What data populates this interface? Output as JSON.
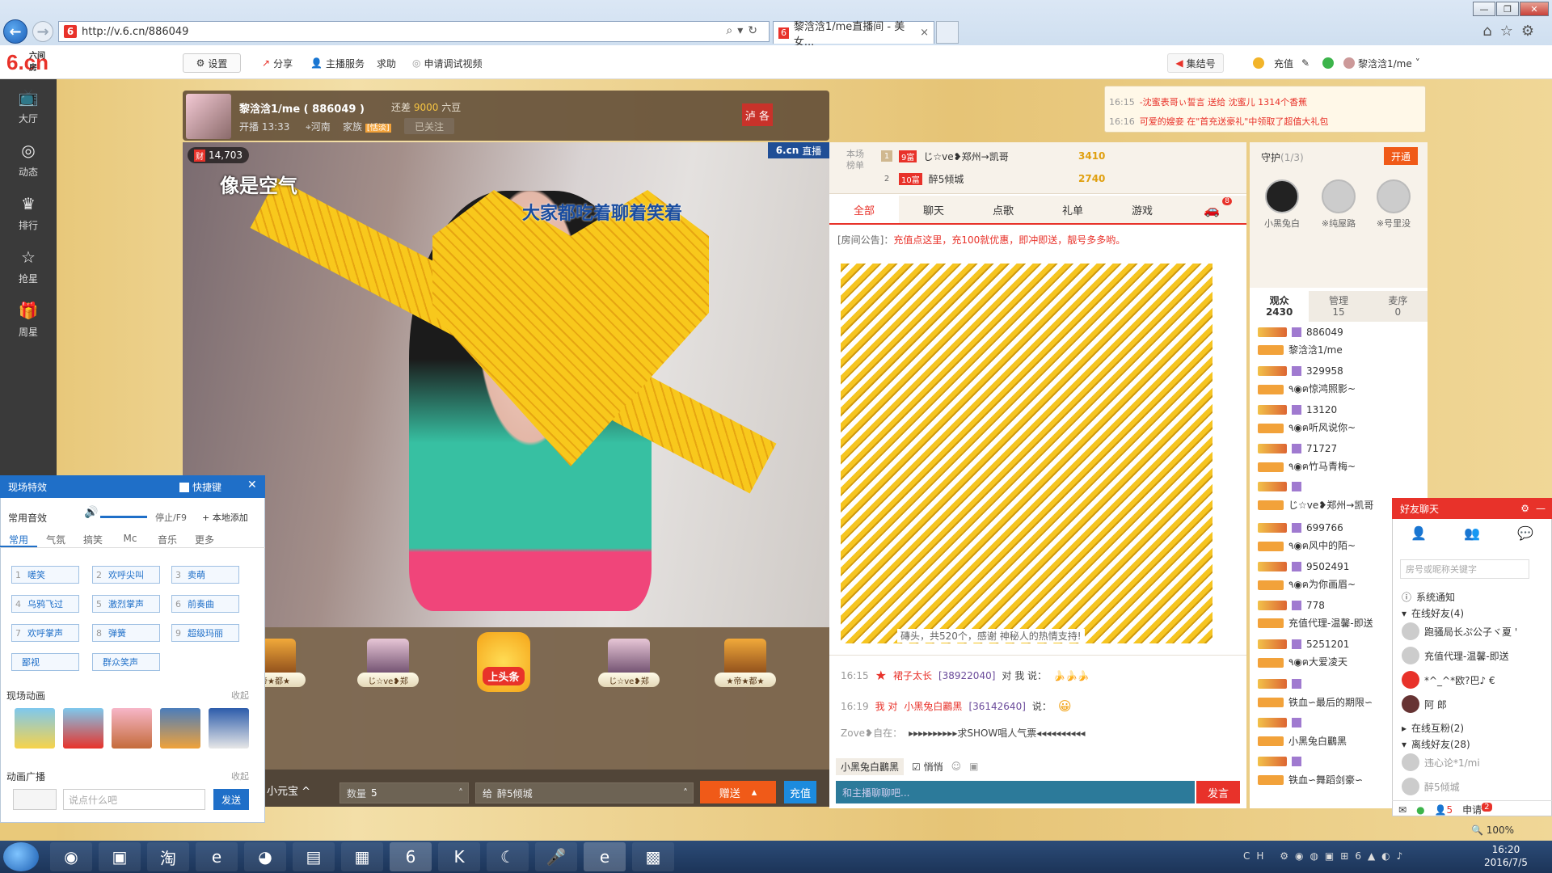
{
  "browser": {
    "url": "http://v.6.cn/886049",
    "tab_title": "黎浛浛1/me直播间 - 美女...",
    "tab_close": "×"
  },
  "site": {
    "logo": "6.cn",
    "logo_small": "六间房",
    "settings": "设置",
    "share": "分享",
    "anchor_service": "主播服务",
    "help": "求助",
    "apply_debug": "申请调试视频",
    "jiejie": "集结号",
    "recharge": "充值",
    "username": "黎浛浛1/me"
  },
  "left_nav": [
    {
      "label": "大厅",
      "icon": "tv-icon"
    },
    {
      "label": "动态",
      "icon": "compass-icon"
    },
    {
      "label": "排行",
      "icon": "crown-icon"
    },
    {
      "label": "抢星",
      "icon": "star-icon"
    },
    {
      "label": "周星",
      "icon": "gift-icon"
    }
  ],
  "anchor": {
    "name": "黎浛浛1/me ( 886049 )",
    "diff_prefix": "还差",
    "diff_value": "9000",
    "diff_suffix": "六豆",
    "started": "开播 13:33",
    "location": "河南",
    "family_label": "家族",
    "family_badge": "[恬淡]",
    "follow": "已关注",
    "flag": "泸 各"
  },
  "video": {
    "viewers": "14,703",
    "text1": "像是空气",
    "text2": "大家都吃着聊着笑着",
    "brand": "6.cn",
    "live": "直播"
  },
  "gifts": [
    {
      "label": "帝★都★"
    },
    {
      "label": "じ☆ve❥郑"
    },
    {
      "label": "上头条"
    },
    {
      "label": "じ☆ve❥郑"
    },
    {
      "label": "★帝★都★"
    }
  ],
  "send": {
    "treasure": "小元宝 ^",
    "qty_label": "数量",
    "qty": "5",
    "to_label": "给",
    "to": "醉5倾城",
    "give": "赠送",
    "charge": "充值"
  },
  "rank": {
    "label": "本场榜单",
    "rows": [
      {
        "n": "1",
        "level": "9富",
        "name": "じ☆ve❥郑州→凯哥",
        "val": "3410"
      },
      {
        "n": "2",
        "level": "10富",
        "name": "醉5倾城",
        "val": "2740"
      }
    ]
  },
  "chat_tabs": [
    "全部",
    "聊天",
    "点歌",
    "礼单",
    "游戏"
  ],
  "chat_tab_badge": "8",
  "notice": {
    "label": "[房间公告]：",
    "text": "充值点这里，充100就优惠，即冲即送，靓号多多哟。"
  },
  "pencil_caption": "磚头，共520个，感谢 神秘人的热情支持!",
  "chat": [
    {
      "time": "16:15",
      "name": "裙子太长",
      "id": "[38922040]",
      "text": "对 我 说："
    },
    {
      "time": "16:19",
      "name": "我 对",
      "target": "小黑兔白鸝黑",
      "id": "[36142640]",
      "text": "说："
    },
    {
      "time": "",
      "name": "Zove❥自在：",
      "text": "▸▸▸▸▸▸▸▸▸▸求SHOW唱人气票◂◂◂◂◂◂◂◂◂◂"
    }
  ],
  "chat_bar": {
    "target": "小黑兔白鸝黑",
    "quiet": "悄悄"
  },
  "chat_input": {
    "placeholder": "和主播聊聊吧...",
    "send": "发言"
  },
  "messages": [
    {
      "time": "16:15",
      "text": "-沈蜜表哥ぃ誓言 送给 沈蜜儿 1314个香蕉"
    },
    {
      "time": "16:16",
      "text": "可爱的嫂妾 在\"首充送豪礼\"中领取了超值大礼包"
    }
  ],
  "guard": {
    "title": "守护",
    "count": "(1/3)",
    "open": "开通",
    "members": [
      "小黑兔白",
      "※纯屋路",
      "※号里没"
    ]
  },
  "user_tabs": [
    {
      "label": "观众",
      "count": "2430"
    },
    {
      "label": "管理",
      "count": "15"
    },
    {
      "label": "麦序",
      "count": "0"
    }
  ],
  "users": [
    {
      "id": "886049",
      "sub": "黎浛浛1/me"
    },
    {
      "id": "329958",
      "sub": "٩◉ฅ惊鸿照影~"
    },
    {
      "id": "13120",
      "sub": "٩◉ฅ听风说你~"
    },
    {
      "id": "71727",
      "sub": "٩◉ฅ竹马青梅~"
    },
    {
      "id": "",
      "sub": "じ☆ve❥郑州→凯哥"
    },
    {
      "id": "699766",
      "sub": "٩◉ฅ风中的陌~"
    },
    {
      "id": "9502491",
      "sub": "٩◉ฅ为你画眉~"
    },
    {
      "id": "778",
      "sub": "充值代理-温馨-即送"
    },
    {
      "id": "5251201",
      "sub": "٩◉ฅ大爱凌天"
    },
    {
      "id": "",
      "sub": "铁血∽最后的期限∽"
    },
    {
      "id": "",
      "sub": "小黑兔白鸝黑"
    },
    {
      "id": "",
      "sub": "铁血∽舞蹈剑豪∽"
    }
  ],
  "sound": {
    "title": "现场特效",
    "shortcut": "快捷键",
    "common": "常用音效",
    "stop": "停止/F9",
    "add": "本地添加",
    "tabs": [
      "常用",
      "气氛",
      "搞笑",
      "Mc",
      "音乐",
      "更多"
    ],
    "buttons": [
      {
        "k": "1",
        "l": "嗟笑"
      },
      {
        "k": "2",
        "l": "欢呼尖叫"
      },
      {
        "k": "3",
        "l": "卖萌"
      },
      {
        "k": "4",
        "l": "乌鸦飞过"
      },
      {
        "k": "5",
        "l": "激烈掌声"
      },
      {
        "k": "6",
        "l": "前奏曲"
      },
      {
        "k": "7",
        "l": "欢呼掌声"
      },
      {
        "k": "8",
        "l": "弹簧"
      },
      {
        "k": "9",
        "l": "超级玛丽"
      },
      {
        "k": "",
        "l": "鄙视"
      },
      {
        "k": "",
        "l": "群众笑声"
      }
    ],
    "anim_title": "现场动画",
    "collapse": "收起",
    "broadcast": "动画广播",
    "bc_placeholder": "说点什么吧",
    "bc_send": "发送"
  },
  "friends": {
    "title": "好友聊天",
    "search": "房号或昵称关键字",
    "sys": "系统通知",
    "online": "在线好友(4)",
    "list": [
      "跑骚局长ぷ公子ヾ夏 '",
      "充值代理-温馨-即送",
      "*^_^*欧?巴♪ €",
      "阿 郎"
    ],
    "fans": "在线互粉(2)",
    "offline": "离线好友(28)",
    "off_list": [
      "违心论*1/mi",
      "醉5倾城"
    ],
    "foot_badge": "2",
    "foot_apply": "申请",
    "foot_count": "5"
  },
  "zoom": "100%",
  "clock": {
    "time": "16:20",
    "date": "2016/7/5"
  },
  "tray_lang": "CH"
}
